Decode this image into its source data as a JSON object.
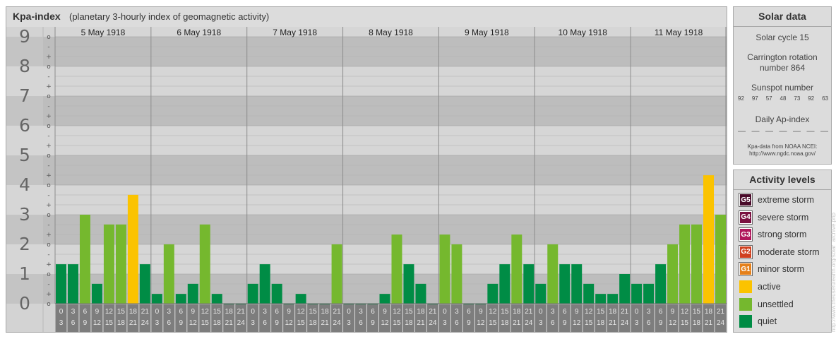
{
  "chart": {
    "title": "Kpa-index",
    "subtitle": "(planetary 3-hourly index of geomagnetic activity)"
  },
  "solar": {
    "heading": "Solar data",
    "cycle": "Solar cycle 15",
    "carrington_line1": "Carrington rotation",
    "carrington_line2": "number 864",
    "sunspot_label": "Sunspot number",
    "sunspot_values": [
      "92",
      "97",
      "57",
      "48",
      "73",
      "92",
      "63"
    ],
    "ap_label": "Daily Ap-index",
    "ap_values": [
      "—",
      "—",
      "—",
      "—",
      "—",
      "—",
      "—"
    ],
    "source_line1": "Kpa-data from NOAA NCEI:",
    "source_line2": "http://www.ngdc.noaa.gov/"
  },
  "levels": {
    "heading": "Activity levels",
    "items": [
      {
        "code": "G5",
        "label": "extreme storm",
        "color": "#4a0b2a"
      },
      {
        "code": "G4",
        "label": "severe storm",
        "color": "#7a1040"
      },
      {
        "code": "G3",
        "label": "strong storm",
        "color": "#b0175c"
      },
      {
        "code": "G2",
        "label": "moderate storm",
        "color": "#d0401f"
      },
      {
        "code": "G1",
        "label": "minor storm",
        "color": "#e5801a"
      },
      {
        "code": "",
        "label": "active",
        "color": "#fbc300"
      },
      {
        "code": "",
        "label": "unsettled",
        "color": "#75b82e"
      },
      {
        "code": "",
        "label": "quiet",
        "color": "#008c45"
      }
    ]
  },
  "credit": "http://www.theusefulearth.org/solar_archive.php",
  "chart_data": {
    "type": "bar",
    "title": "Kpa-index",
    "subtitle": "(planetary 3-hourly index of geomagnetic activity)",
    "days": [
      "5 May 1918",
      "6 May 1918",
      "7 May 1918",
      "8 May 1918",
      "9 May 1918",
      "10 May 1918",
      "11 May 1918"
    ],
    "interval_labels": [
      [
        "0",
        "3"
      ],
      [
        "3",
        "6"
      ],
      [
        "6",
        "9"
      ],
      [
        "9",
        "12"
      ],
      [
        "12",
        "15"
      ],
      [
        "15",
        "18"
      ],
      [
        "18",
        "21"
      ],
      [
        "21",
        "24"
      ]
    ],
    "ylim": [
      0,
      9
    ],
    "y_ticks": [
      "0",
      "1",
      "2",
      "3",
      "4",
      "5",
      "6",
      "7",
      "8",
      "9"
    ],
    "y_subticks": [
      "o",
      "+",
      "-",
      "o",
      "+",
      "-",
      "o",
      "+",
      "-",
      "o",
      "+",
      "-",
      "o",
      "+",
      "-",
      "o",
      "+",
      "-",
      "o",
      "+",
      "-",
      "o",
      "+",
      "-",
      "o",
      "+",
      "-",
      "o"
    ],
    "values": [
      [
        1.33,
        1.33,
        3.0,
        0.67,
        2.67,
        2.67,
        3.67,
        1.33
      ],
      [
        0.33,
        2.0,
        0.33,
        0.67,
        2.67,
        0.33,
        0.0,
        0.0
      ],
      [
        0.67,
        1.33,
        0.67,
        0.0,
        0.33,
        0.0,
        0.0,
        2.0
      ],
      [
        0.0,
        0.0,
        0.0,
        0.33,
        2.33,
        1.33,
        0.67,
        0.0
      ],
      [
        2.33,
        2.0,
        0.0,
        0.0,
        0.67,
        1.33,
        2.33,
        1.33
      ],
      [
        0.67,
        2.0,
        1.33,
        1.33,
        0.67,
        0.33,
        0.33,
        1.0
      ],
      [
        0.67,
        0.67,
        1.33,
        2.0,
        2.67,
        2.67,
        4.33,
        3.0
      ]
    ],
    "colors": {
      "quiet": "#008c45",
      "unsettled": "#75b82e",
      "active": "#fbc300"
    },
    "grid": true
  }
}
